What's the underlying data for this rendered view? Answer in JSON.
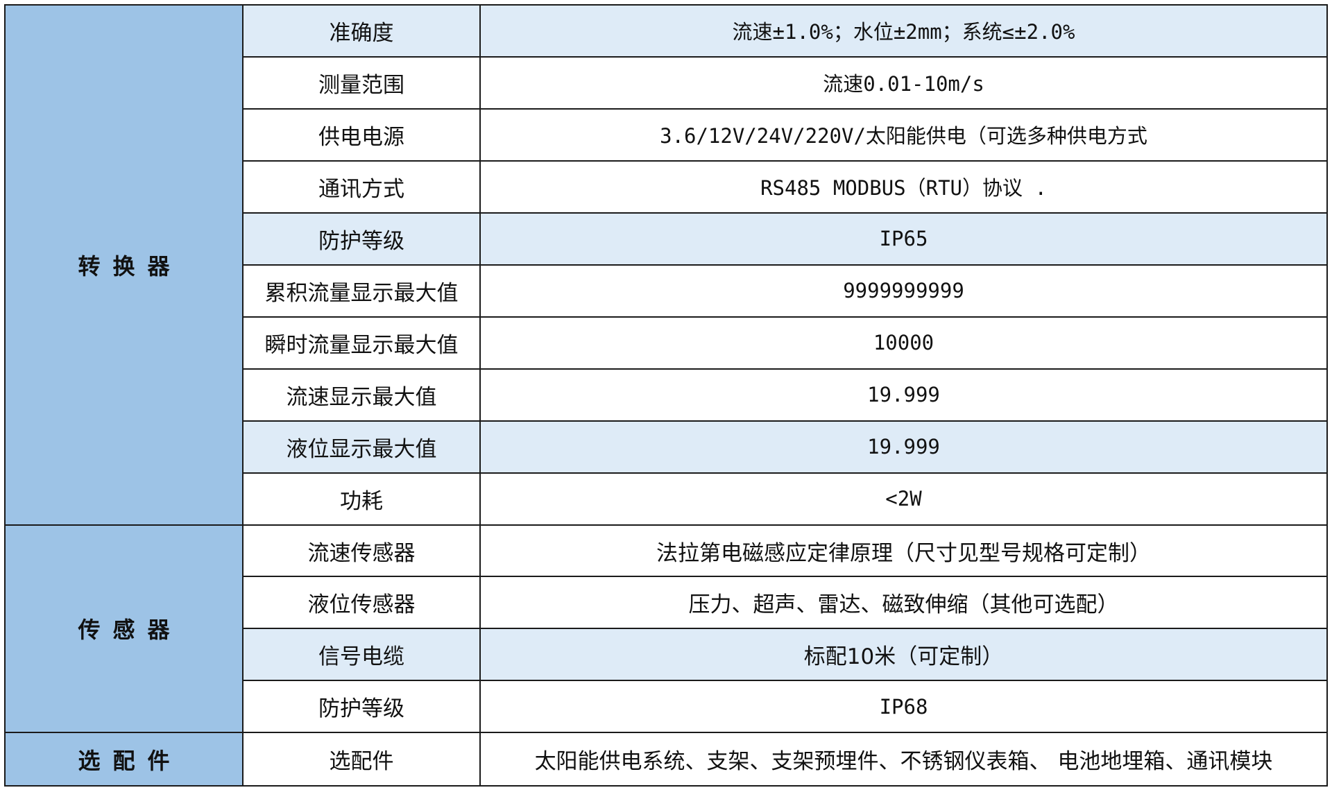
{
  "groups": {
    "converter": "转换器",
    "sensor": "传感器",
    "accessory": "选配件"
  },
  "rows": [
    {
      "param": "准确度",
      "value": "流速±1.0%；水位±2mm；系统≤±2.0%"
    },
    {
      "param": "测量范围",
      "value": "流速0.01-10m/s"
    },
    {
      "param": "供电电源",
      "value": "3.6/12V/24V/220V/太阳能供电（可选多种供电方式"
    },
    {
      "param": "通讯方式",
      "value": "RS485 MODBUS（RTU）协议 ."
    },
    {
      "param": "防护等级",
      "value": "IP65"
    },
    {
      "param": "累积流量显示最大值",
      "value": "9999999999"
    },
    {
      "param": "瞬时流量显示最大值",
      "value": "10000"
    },
    {
      "param": "流速显示最大值",
      "value": "19.999"
    },
    {
      "param": "液位显示最大值",
      "value": "19.999"
    },
    {
      "param": "功耗",
      "value": "<2W"
    },
    {
      "param": "流速传感器",
      "value": "法拉第电磁感应定律原理（尺寸见型号规格可定制）"
    },
    {
      "param": "液位传感器",
      "value": "压力、超声、雷达、磁致伸缩（其他可选配）"
    },
    {
      "param": "信号电缆",
      "value": "标配10米（可定制）"
    },
    {
      "param": "防护等级",
      "value": "IP68"
    },
    {
      "param": "选配件",
      "value": "太阳能供电系统、支架、支架预埋件、不锈钢仪表箱、 电池地埋箱、通讯模块"
    }
  ],
  "colors": {
    "group_bg": "#9dc3e6",
    "shade_bg": "#deebf7",
    "border": "#1a1a1a"
  }
}
